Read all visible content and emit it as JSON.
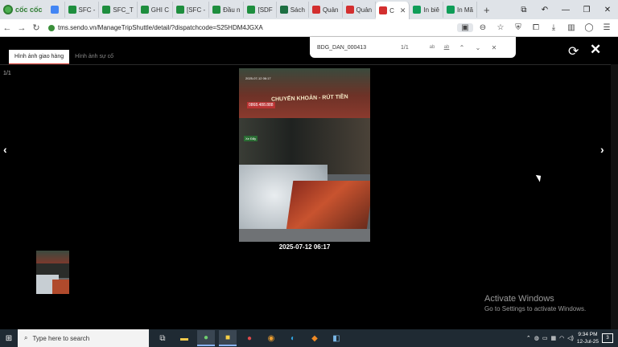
{
  "browser": {
    "brand": "cốc cốc",
    "tabs": [
      {
        "label": "",
        "fav": "#4285f4"
      },
      {
        "label": "SFC -",
        "fav": "#1e8e3e"
      },
      {
        "label": "SFC_T",
        "fav": "#1e8e3e"
      },
      {
        "label": "GHI C",
        "fav": "#1e8e3e"
      },
      {
        "label": "[SFC -",
        "fav": "#1e8e3e"
      },
      {
        "label": "Đầu n",
        "fav": "#1e8e3e"
      },
      {
        "label": "[SDF",
        "fav": "#1e8e3e"
      },
      {
        "label": "Sách",
        "fav": "#1d6f42"
      },
      {
        "label": "Quản",
        "fav": "#d32f2f"
      },
      {
        "label": "Quản",
        "fav": "#d32f2f"
      },
      {
        "label": "C",
        "fav": "#d32f2f",
        "active": true
      },
      {
        "label": "In biê",
        "fav": "#0f9d58"
      },
      {
        "label": "In Mã",
        "fav": "#0f9d58"
      }
    ],
    "url": "tms.sendo.vn/ManageTripShuttle/detail/?dispatchcode=S25HDM4JGXA"
  },
  "viewer": {
    "tabs": [
      "Hình ảnh giao hàng",
      "Hình ảnh sự cố"
    ],
    "counter": "1/1",
    "photo": {
      "sign_text": "CHUYỂN KHOẢN - RÚT TIỀN",
      "stamp_text": "2025-07-12 06:17",
      "phone_text": "0868.488.888",
      "sticker_text": "Xe Đẩy"
    },
    "timestamp": "2025-07-12 06:17"
  },
  "find": {
    "query": "BDG_DAN_000413",
    "count": "1/1",
    "opt1": "ab",
    "opt2": "ab"
  },
  "activation": {
    "title": "Activate Windows",
    "subtitle": "Go to Settings to activate Windows."
  },
  "taskbar": {
    "search_placeholder": "Type here to search",
    "time": "9:34 PM",
    "date": "12-Jul-25",
    "notifications": "3"
  }
}
